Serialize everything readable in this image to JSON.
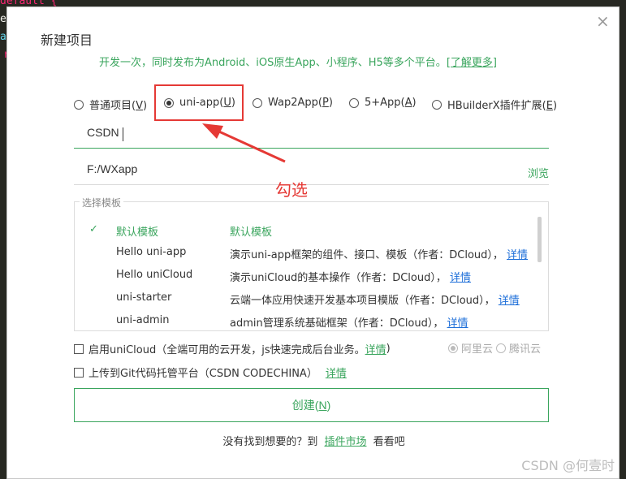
{
  "editor": {
    "snippet_top": "default {",
    "snippet_e": "e",
    "snippet_a": "a",
    "snippet_r": "r"
  },
  "dialog": {
    "title": "新建项目",
    "subtitle": "开发一次，同时发布为Android、iOS原生App、小程序、H5等多个平台。",
    "subtitle_link": "[了解更多]",
    "project_types": [
      {
        "label_prefix": "普通项目(",
        "key": "V",
        "label_suffix": ")",
        "checked": false
      },
      {
        "label_prefix": "uni-app(",
        "key": "U",
        "label_suffix": ")",
        "checked": true
      },
      {
        "label_prefix": "Wap2App(",
        "key": "P",
        "label_suffix": ")",
        "checked": false
      },
      {
        "label_prefix": "5+App(",
        "key": "A",
        "label_suffix": ")",
        "checked": false
      },
      {
        "label_prefix": "HBuilderX插件扩展(",
        "key": "E",
        "label_suffix": ")",
        "checked": false
      }
    ],
    "project_name": "CSDN",
    "project_path": "F:/WXapp",
    "browse_label": "浏览",
    "annotation": "勾选",
    "template_legend": "选择模板",
    "templates": [
      {
        "check": "✓",
        "name": "默认模板",
        "desc": "默认模板",
        "detail": "",
        "selected": true
      },
      {
        "check": "",
        "name": "Hello uni-app",
        "desc": "演示uni-app框架的组件、接口、模板（作者：DCloud），",
        "detail": "详情",
        "selected": false
      },
      {
        "check": "",
        "name": "Hello uniCloud",
        "desc": "演示uniCloud的基本操作（作者：DCloud），",
        "detail": "详情",
        "selected": false
      },
      {
        "check": "",
        "name": "uni-starter",
        "desc": "云端一体应用快速开发基本项目模版（作者：DCloud），",
        "detail": "详情",
        "selected": false
      },
      {
        "check": "",
        "name": "uni-admin",
        "desc": "admin管理系统基础框架（作者：DCloud），",
        "detail": "详情",
        "selected": false
      }
    ],
    "unicloud": {
      "label": "启用uniCloud（全端可用的云开发，js快速完成后台业务。",
      "link": "详情",
      "suffix": ")"
    },
    "providers": [
      "阿里云",
      "腾讯云"
    ],
    "git": {
      "label": "上传到Git代码托管平台（CSDN CODECHINA）",
      "link": "详情"
    },
    "create_label_prefix": "创建(",
    "create_key": "N",
    "create_label_suffix": ")",
    "footer_prefix": "没有找到想要的？到",
    "footer_link": "插件市场",
    "footer_suffix": "看看吧"
  },
  "watermark": "CSDN @何壹时",
  "colors": {
    "accent": "#3aa55d",
    "annotation": "#e53935",
    "link_blue": "#1e6fd9"
  }
}
